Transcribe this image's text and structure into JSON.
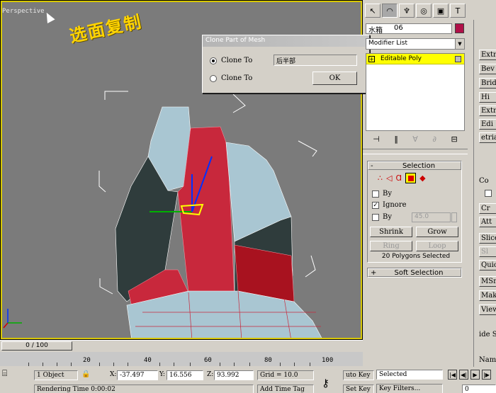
{
  "viewport": {
    "label": "Perspective",
    "annotation": "选面复制"
  },
  "dialog": {
    "title": "Clone Part of Mesh",
    "option_clone_to_object": "Clone To",
    "option_clone_to_element": "Clone To",
    "object_name": "后半部",
    "ok_label": "OK"
  },
  "command_panel": {
    "object_name": "水箱",
    "object_number": "06",
    "object_color": "#b01048",
    "modifier_list": "Modifier List",
    "stack_item": "Editable Poly",
    "selection": {
      "title": "Selection",
      "by_vertex": "By",
      "ignore_backfacing": "Ignore",
      "by_angle": "By",
      "angle_value": "45.0",
      "shrink": "Shrink",
      "grow": "Grow",
      "ring": "Ring",
      "loop": "Loop",
      "count": "20 Polygons Selected"
    },
    "soft_selection": "Soft Selection"
  },
  "right_column": {
    "buttons": [
      "Extr",
      "Bev",
      "Brid",
      "Hi",
      "Extru",
      "Edi",
      "etria",
      "Cr",
      "Att",
      "Slice",
      "Sl",
      "Quic",
      "MSmo",
      "Make",
      "View"
    ],
    "labels": [
      "Co",
      "ide S",
      "Name"
    ]
  },
  "timeline": {
    "frame": "0 / 100",
    "ruler": [
      "20",
      "40",
      "60",
      "80",
      "100"
    ]
  },
  "status": {
    "objects": "1 Object",
    "x_label": "X:",
    "x_value": "-37.497",
    "y_label": "Y:",
    "y_value": "16.556",
    "z_label": "Z:",
    "z_value": "93.992",
    "grid": "Grid = 10.0",
    "rendering": "Rendering Time  0:00:02",
    "add_time_tag": "Add Time Tag",
    "auto_key": "uto Key",
    "set_key": "Set Key",
    "selected": "Selected",
    "key_filters": "Key Filters...",
    "frame_field": "0"
  },
  "colors": {
    "selection_red": "#c8283c",
    "mesh_blue": "#a9c6d2",
    "mesh_dark": "#2e3b3b",
    "highlight": "#ffff00"
  }
}
